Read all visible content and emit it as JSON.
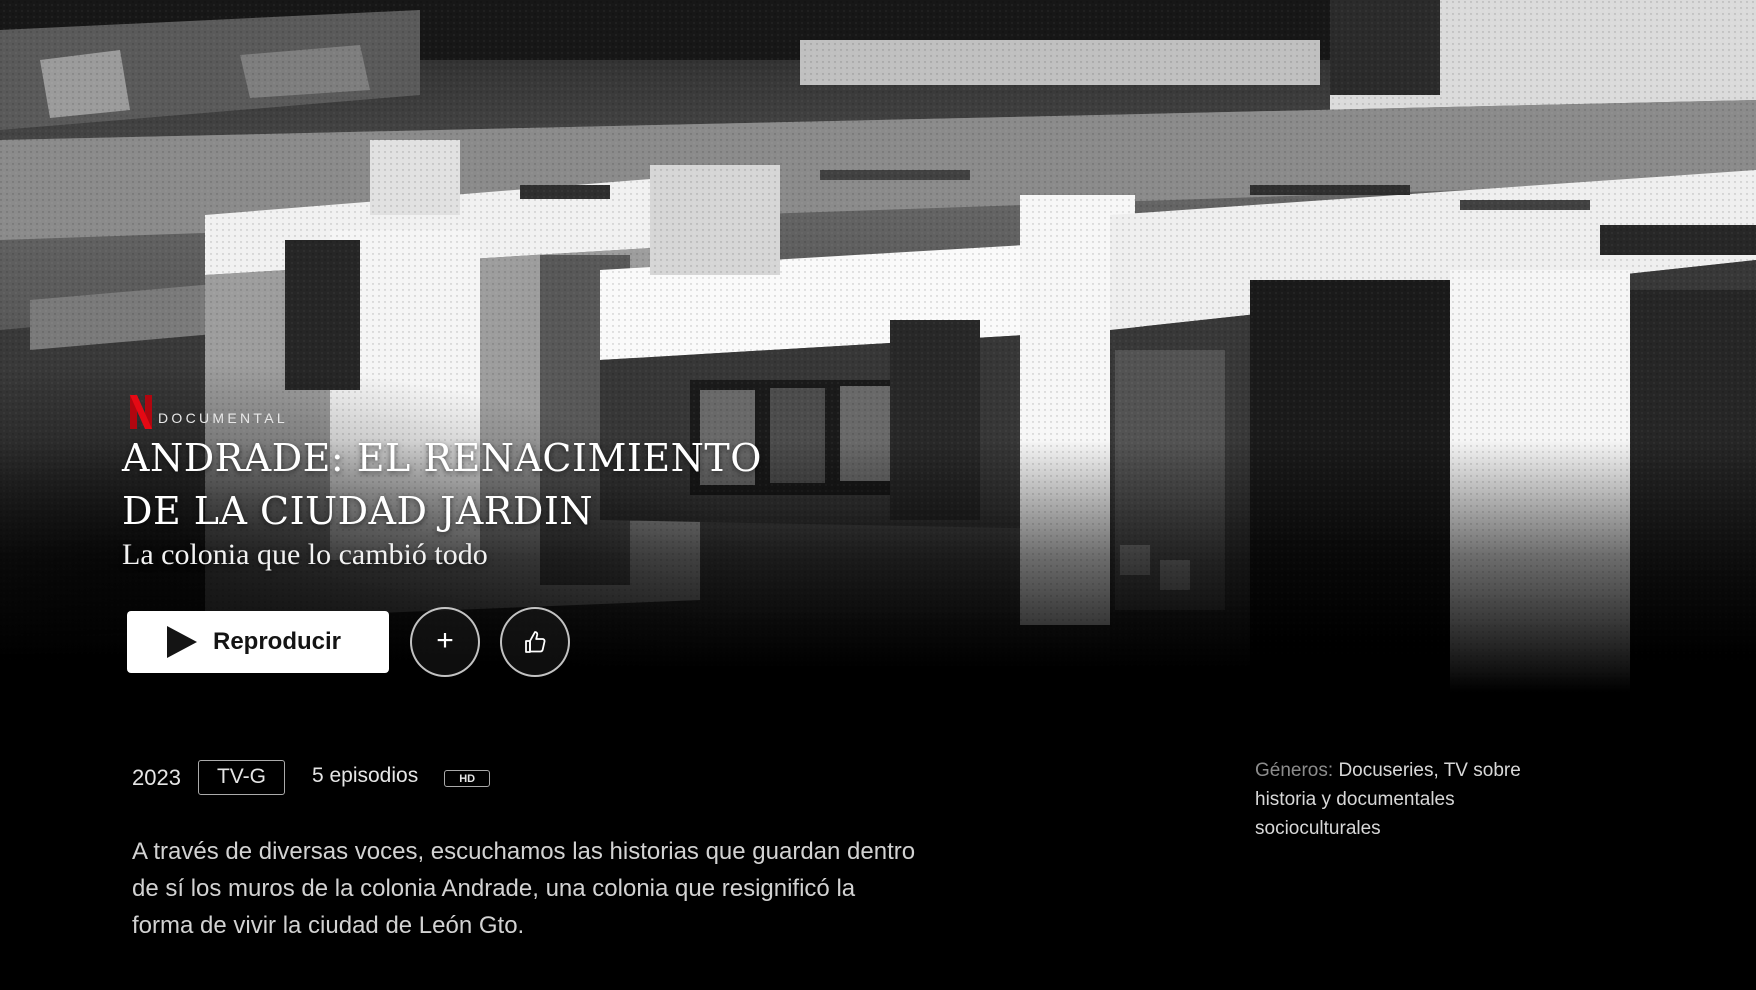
{
  "hero": {
    "category_label": "DOCUMENTAL",
    "title_line_1": "ANDRADE: EL RENACIMIENTO",
    "title_line_2": "DE LA CIUDAD JARDIN",
    "subtitle": "La colonia que lo cambió todo"
  },
  "actions": {
    "play_label": "Reproducir",
    "add_symbol": "+"
  },
  "meta": {
    "year": "2023",
    "rating": "TV-G",
    "episodes": "5 episodios",
    "quality": "HD"
  },
  "description": "A través de diversas voces, escuchamos las historias que guardan dentro de sí los muros de la colonia Andrade, una colonia que resignificó la forma de vivir la ciudad de León Gto.",
  "genres": {
    "label": "Géneros:",
    "value": "Docuseries, TV sobre historia y documentales socioculturales"
  },
  "colors": {
    "background": "#000000",
    "brand_red": "#E50914",
    "play_button_bg": "#FFFFFF",
    "text_secondary": "#8C8C8C"
  },
  "icons": {
    "brand": "netflix-n-logo",
    "play": "play-icon",
    "add": "plus-icon",
    "rate": "thumbs-up-icon"
  }
}
